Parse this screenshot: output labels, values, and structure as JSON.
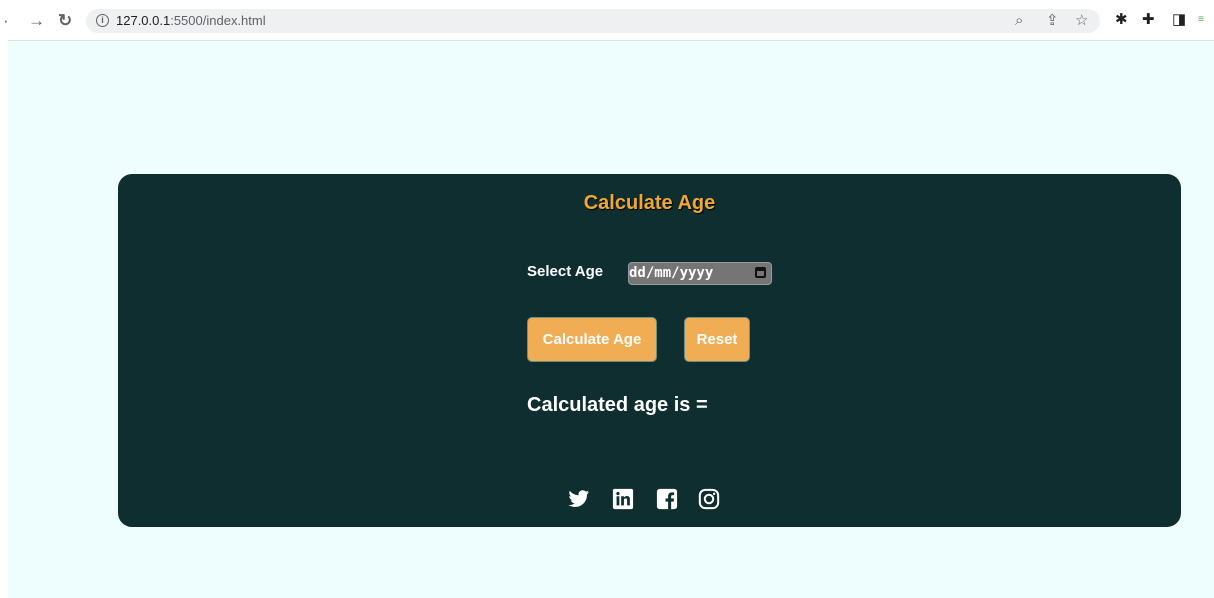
{
  "browser": {
    "url_host": "127.0.0.1",
    "url_rest": ":5500/index.html",
    "icons": [
      "back-icon",
      "forward-icon",
      "reload-icon",
      "info-icon",
      "zoom-icon",
      "share-icon",
      "star-icon",
      "extension-bug-icon",
      "puzzle-icon",
      "sidebar-icon"
    ]
  },
  "card": {
    "title": "Calculate Age",
    "select_label": "Select Age",
    "date_placeholder": "dd/mm/yyyy",
    "calculate_button": "Calculate Age",
    "reset_button": "Reset",
    "result_text": "Calculated age is ="
  },
  "social": {
    "icons": [
      "twitter-icon",
      "linkedin-icon",
      "facebook-icon",
      "instagram-icon"
    ]
  },
  "colors": {
    "page_background": "#eefefe",
    "card_background": "#0f2e2f",
    "title_color": "#f1a732",
    "button_color": "#f0ad54"
  }
}
